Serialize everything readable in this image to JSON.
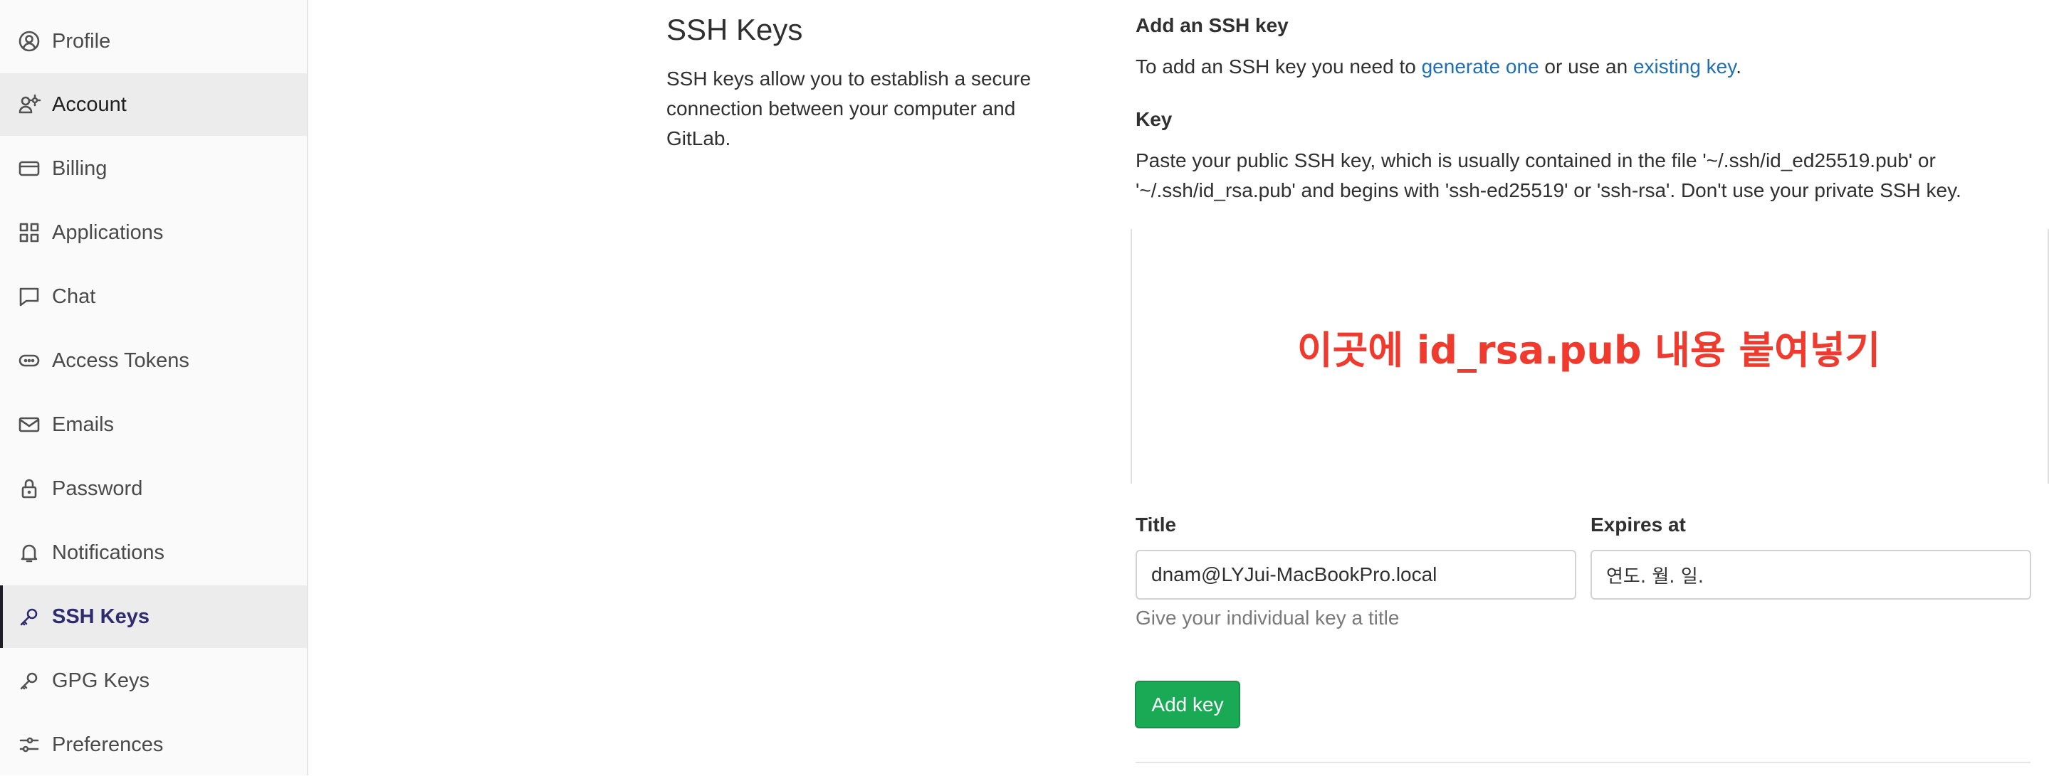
{
  "sidebar": {
    "items": [
      {
        "label": "Profile",
        "icon": "profile-icon",
        "state": "normal"
      },
      {
        "label": "Account",
        "icon": "account-icon",
        "state": "hover"
      },
      {
        "label": "Billing",
        "icon": "credit-card-icon",
        "state": "normal"
      },
      {
        "label": "Applications",
        "icon": "applications-grid-icon",
        "state": "normal"
      },
      {
        "label": "Chat",
        "icon": "comment-icon",
        "state": "normal"
      },
      {
        "label": "Access Tokens",
        "icon": "token-icon",
        "state": "normal"
      },
      {
        "label": "Emails",
        "icon": "mail-icon",
        "state": "normal"
      },
      {
        "label": "Password",
        "icon": "lock-icon",
        "state": "normal"
      },
      {
        "label": "Notifications",
        "icon": "bell-icon",
        "state": "normal"
      },
      {
        "label": "SSH Keys",
        "icon": "key-icon",
        "state": "active"
      },
      {
        "label": "GPG Keys",
        "icon": "key-icon",
        "state": "normal"
      },
      {
        "label": "Preferences",
        "icon": "preferences-icon",
        "state": "normal"
      }
    ]
  },
  "section": {
    "title": "SSH Keys",
    "description": "SSH keys allow you to establish a secure connection between your computer and GitLab."
  },
  "add_key": {
    "heading": "Add an SSH key",
    "intro_prefix": "To add an SSH key you need to ",
    "generate_link": "generate one",
    "intro_middle": " or use an ",
    "existing_link": "existing key",
    "intro_suffix": ".",
    "key_label": "Key",
    "key_help_line1": "Paste your public SSH key, which is usually contained in the file '~/.ssh/id_ed25519.pub' or",
    "key_help_line2": "'~/.ssh/id_rsa.pub' and begins with 'ssh-ed25519' or 'ssh-rsa'. Don't use your private SSH key.",
    "key_overlay_text": "이곳에 id_rsa.pub 내용 붙여넣기",
    "title_label": "Title",
    "title_value": "dnam@LYJui-MacBookPro.local",
    "title_hint": "Give your individual key a title",
    "expires_label": "Expires at",
    "expires_value": "연도. 월. 일.",
    "submit_label": "Add key"
  },
  "colors": {
    "link": "#1f6fb2",
    "button_green": "#1aaa55",
    "active_nav": "#2e2c6e",
    "overlay_red": "#f03a2e"
  }
}
